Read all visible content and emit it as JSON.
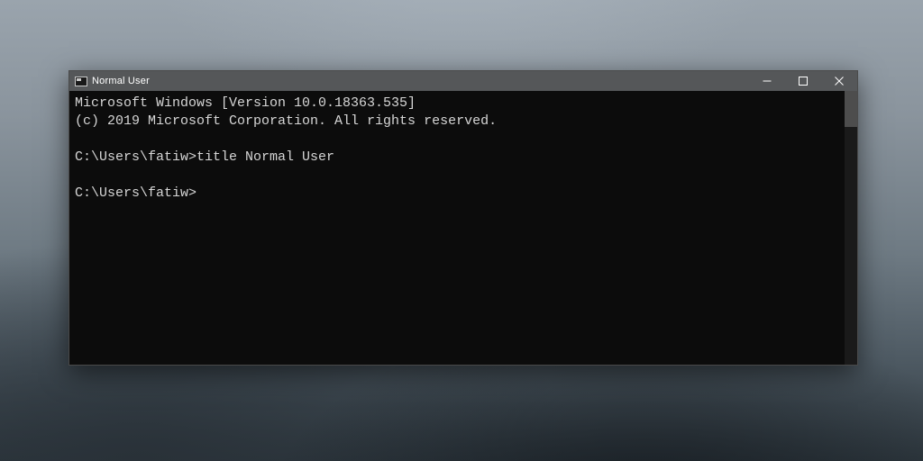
{
  "window": {
    "title": "Normal User"
  },
  "terminal": {
    "lines": [
      "Microsoft Windows [Version 10.0.18363.535]",
      "(c) 2019 Microsoft Corporation. All rights reserved.",
      "",
      "C:\\Users\\fatiw>title Normal User",
      "",
      "C:\\Users\\fatiw>"
    ]
  }
}
